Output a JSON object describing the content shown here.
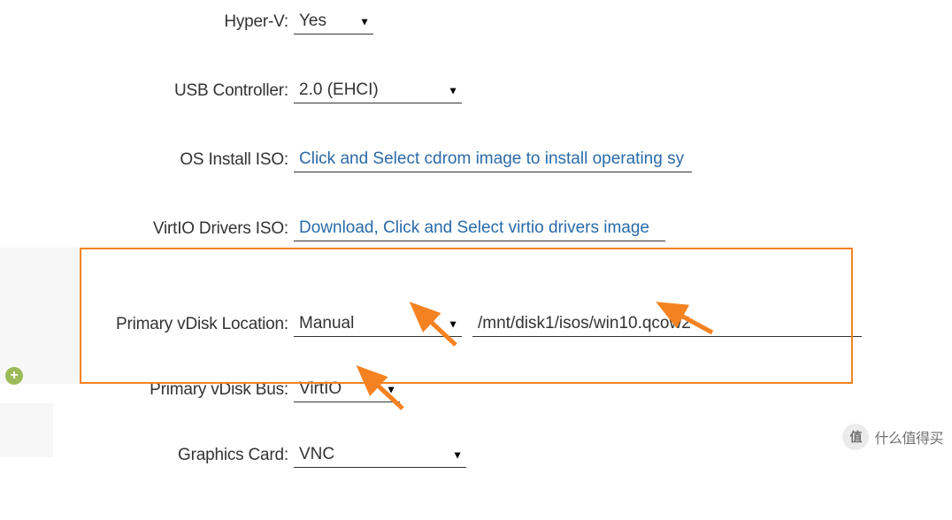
{
  "fields": {
    "hyperv": {
      "label": "Hyper-V:",
      "value": "Yes"
    },
    "usb": {
      "label": "USB Controller:",
      "value": "2.0 (EHCI)"
    },
    "osiso": {
      "label": "OS Install ISO:",
      "placeholder": "Click and Select cdrom image to install operating sy"
    },
    "virtio_iso": {
      "label": "VirtIO Drivers ISO:",
      "placeholder": "Download, Click and Select virtio drivers image"
    },
    "vdisk_loc": {
      "label": "Primary vDisk Location:",
      "value": "Manual",
      "path": "/mnt/disk1/isos/win10.qcow2"
    },
    "vdisk_bus": {
      "label": "Primary vDisk Bus:",
      "value": "VirtIO"
    },
    "gfx": {
      "label": "Graphics Card:",
      "value": "VNC"
    }
  },
  "watermark": {
    "logo_text": "值",
    "text": "什么值得买"
  }
}
